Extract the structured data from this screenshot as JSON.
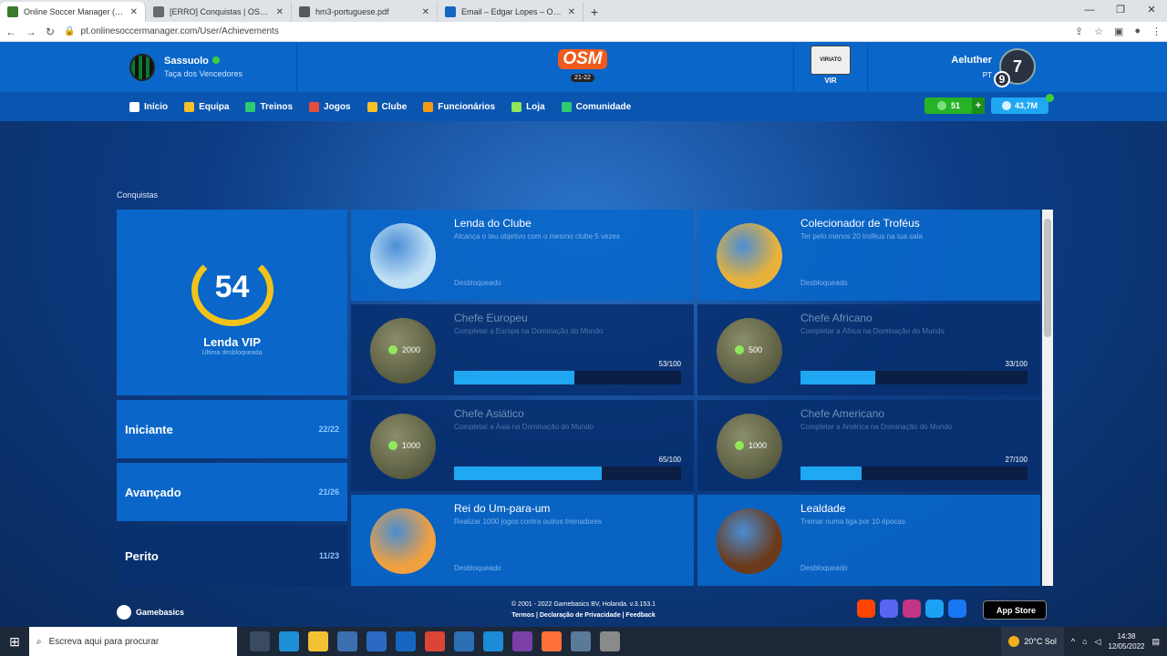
{
  "browser": {
    "tabs": [
      {
        "title": "Online Soccer Manager (OSM) -",
        "color": "#3a7a2a",
        "active": true
      },
      {
        "title": "[ERRO] Conquistas | OSM Forum",
        "color": "#6a6a6a",
        "active": false
      },
      {
        "title": "hm3-portuguese.pdf",
        "color": "#5a5a5a",
        "active": false
      },
      {
        "title": "Email – Edgar Lopes – Outlook",
        "color": "#1566c0",
        "active": false
      }
    ],
    "url": "pt.onlinesoccermanager.com/User/Achievements"
  },
  "header": {
    "club_name": "Sassuolo",
    "club_competition": "Taça dos Vencedores",
    "logo_text": "OSM",
    "logo_season": "21-22",
    "opponent_badge": "VIRIATO",
    "opponent_label": "VIR",
    "user_name": "Aeluther",
    "user_country": "PT",
    "user_level": "7",
    "user_level_small": "9"
  },
  "nav": [
    {
      "label": "Início",
      "color": "#ffffff"
    },
    {
      "label": "Equipa",
      "color": "#f5c12a"
    },
    {
      "label": "Treinos",
      "color": "#2ecc71"
    },
    {
      "label": "Jogos",
      "color": "#e74c3c"
    },
    {
      "label": "Clube",
      "color": "#f5c12a"
    },
    {
      "label": "Funcionários",
      "color": "#f39c12"
    },
    {
      "label": "Loja",
      "color": "#8ee85a"
    },
    {
      "label": "Comunidade",
      "color": "#2ecc71"
    }
  ],
  "currency": {
    "coins": "51",
    "plus": "+",
    "money": "43,7M"
  },
  "breadcrumb": "Conquistas",
  "summary": {
    "count": "54",
    "title": "Lenda VIP",
    "subtitle": "Última desbloqueada"
  },
  "levels": [
    {
      "name": "Iniciante",
      "count": "22/22"
    },
    {
      "name": "Avançado",
      "count": "21/26"
    },
    {
      "name": "Perito",
      "count": "11/23"
    }
  ],
  "achievements": [
    {
      "name": "Lenda do Clube",
      "desc": "Alcança o teu objetivo com o mesmo clube 5 vezes",
      "status": "Desbloqueado",
      "unlocked": true,
      "img_color": "#bfe0f5"
    },
    {
      "name": "Colecionador de Troféus",
      "desc": "Ter pelo menos 20 troféus na tua sala",
      "status": "Desbloqueado",
      "unlocked": true,
      "img_color": "#e8b23a"
    },
    {
      "name": "Chefe Europeu",
      "desc": "Completar a Europa na Dominação do Mundo",
      "unlocked": false,
      "reward": "2000",
      "progress_text": "53/100",
      "progress": 0.53
    },
    {
      "name": "Chefe Africano",
      "desc": "Completar a África na Dominação do Mundo",
      "unlocked": false,
      "reward": "500",
      "progress_text": "33/100",
      "progress": 0.33
    },
    {
      "name": "Chefe Asiático",
      "desc": "Completar a Ásia na Dominação do Mundo",
      "unlocked": false,
      "reward": "1000",
      "progress_text": "65/100",
      "progress": 0.65
    },
    {
      "name": "Chefe Americano",
      "desc": "Completar a América na Dominação do Mundo",
      "unlocked": false,
      "reward": "1000",
      "progress_text": "27/100",
      "progress": 0.27
    },
    {
      "name": "Rei do Um-para-um",
      "desc": "Realizar 1000 jogos contra outros treinadores",
      "status": "Desbloqueado",
      "unlocked": true,
      "img_color": "#f0a040"
    },
    {
      "name": "Lealdade",
      "desc": "Treinar numa liga por 10 épocas",
      "status": "Desbloqueado",
      "unlocked": true,
      "img_color": "#6a3a1a"
    }
  ],
  "footer": {
    "brand": "Gamebasics",
    "copyright": "© 2001 - 2022 Gamebasics BV, Holanda. v.3.153.1",
    "links": "Termos  |  Declaração de Privacidade  |  Feedback",
    "appstore": "App Store"
  },
  "taskbar": {
    "search_placeholder": "Escreva aqui para procurar",
    "weather": "20°C  Sol",
    "time": "14:38",
    "date": "12/05/2022"
  }
}
